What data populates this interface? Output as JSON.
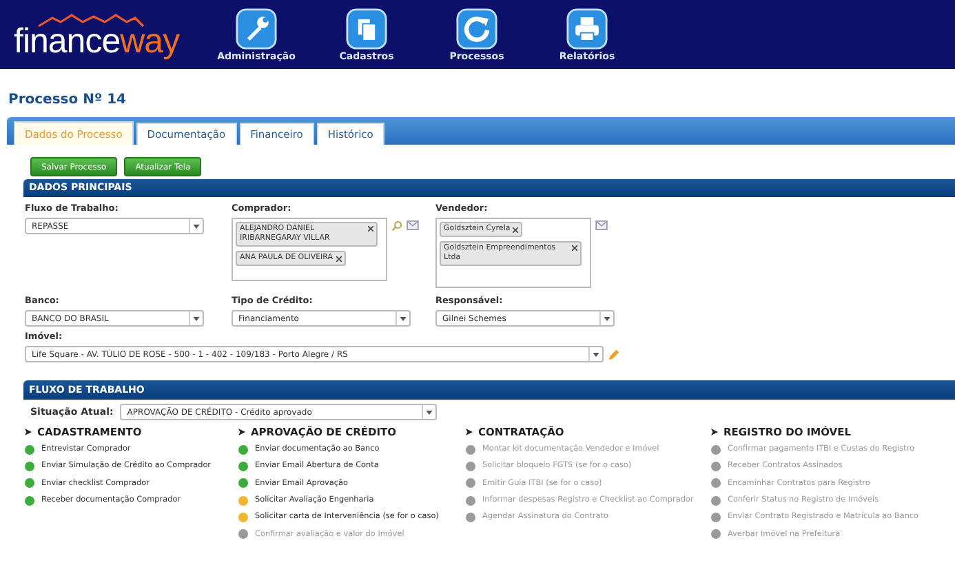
{
  "header": {
    "logo_left": "finance",
    "logo_right": "way",
    "nav": [
      {
        "label": "Administração",
        "kind": "wrench"
      },
      {
        "label": "Cadastros",
        "kind": "copy"
      },
      {
        "label": "Processos",
        "kind": "refresh"
      },
      {
        "label": "Relatórios",
        "kind": "printer"
      }
    ]
  },
  "title": "Processo Nº 14",
  "tabs": [
    {
      "label": "Dados do Processo",
      "selected": true
    },
    {
      "label": "Documentação",
      "selected": false
    },
    {
      "label": "Financeiro",
      "selected": false
    },
    {
      "label": "Histórico",
      "selected": false
    }
  ],
  "buttons": [
    "Salvar Processo",
    "Atualizar Tela"
  ],
  "dados_principais": {
    "title": "DADOS PRINCIPAIS",
    "fluxo": {
      "label": "Fluxo de Trabalho:",
      "value": "REPASSE"
    },
    "comprador": {
      "label": "Comprador:",
      "chips": [
        "ALEJANDRO DANIEL IRIBARNEGARAY VILLAR",
        "ANA PAULA DE OLIVEIRA"
      ]
    },
    "vendedor": {
      "label": "Vendedor:",
      "chips": [
        "Goldsztein Cyrela",
        "Goldsztein Empreendimentos Ltda"
      ]
    },
    "banco": {
      "label": "Banco:",
      "value": "BANCO DO BRASIL"
    },
    "tipo": {
      "label": "Tipo de Crédito:",
      "value": "Financiamento"
    },
    "responsavel": {
      "label": "Responsável:",
      "value": "Gilnei Schemes"
    },
    "imovel": {
      "label": "Imóvel:",
      "value": "Life Square - AV. TÚLIO DE ROSE - 500 - 1 - 402 - 109/183 - Porto Alegre / RS"
    }
  },
  "fluxo_trabalho": {
    "title": "FLUXO DE TRABALHO",
    "situacao_label": "Situação Atual:",
    "situacao_value": "APROVAÇÃO DE CRÉDITO - Crédito aprovado",
    "stages": [
      {
        "title": "CADASTRAMENTO",
        "tasks": [
          {
            "label": "Entrevistar Comprador",
            "color": "#3cac3c",
            "disabled": false
          },
          {
            "label": "Enviar Simulação de Crédito ao Comprador",
            "color": "#3cac3c",
            "disabled": false
          },
          {
            "label": "Enviar checklist Comprador",
            "color": "#3cac3c",
            "disabled": false
          },
          {
            "label": "Receber documentação Comprador",
            "color": "#3cac3c",
            "disabled": false
          }
        ]
      },
      {
        "title": "APROVAÇÃO DE CRÉDITO",
        "tasks": [
          {
            "label": "Enviar documentação ao Banco",
            "color": "#3cac3c",
            "disabled": false
          },
          {
            "label": "Enviar Email Abertura de Conta",
            "color": "#3cac3c",
            "disabled": false
          },
          {
            "label": "Enviar Email Aprovação",
            "color": "#3cac3c",
            "disabled": false
          },
          {
            "label": "Solicitar Avaliação Engenharia",
            "color": "#f3b630",
            "disabled": false
          },
          {
            "label": "Solicitar carta de Interveniência (se for o caso)",
            "color": "#f3b630",
            "disabled": false
          },
          {
            "label": "Confirmar avaliação e valor do Imóvel",
            "color": "#9a9a9a",
            "disabled": true
          }
        ]
      },
      {
        "title": "CONTRATAÇÃO",
        "tasks": [
          {
            "label": "Montar kit documentação Vendedor e Imóvel",
            "color": "#9a9a9a",
            "disabled": true
          },
          {
            "label": "Solicitar bloqueio FGTS (se for o caso)",
            "color": "#9a9a9a",
            "disabled": true
          },
          {
            "label": "Emitir Guia ITBI (se for o caso)",
            "color": "#9a9a9a",
            "disabled": true
          },
          {
            "label": "Informar despesas Registro e Checklist ao Comprador",
            "color": "#9a9a9a",
            "disabled": true
          },
          {
            "label": "Agendar Assinatura do Contrato",
            "color": "#9a9a9a",
            "disabled": true
          }
        ]
      },
      {
        "title": "REGISTRO DO IMÓVEL",
        "tasks": [
          {
            "label": "Confirmar pagamento ITBI e Custas do Registro",
            "color": "#9a9a9a",
            "disabled": true
          },
          {
            "label": "Receber Contratos Assinados",
            "color": "#9a9a9a",
            "disabled": true
          },
          {
            "label": "Encaminhar Contratos para Registro",
            "color": "#9a9a9a",
            "disabled": true
          },
          {
            "label": "Conferir Status no Registro de Imóveis",
            "color": "#9a9a9a",
            "disabled": true
          },
          {
            "label": "Enviar Contrato Registrado e Matrícula ao Banco",
            "color": "#9a9a9a",
            "disabled": true
          },
          {
            "label": "Averbar Imóvel na Prefeitura",
            "color": "#9a9a9a",
            "disabled": true
          }
        ]
      }
    ]
  }
}
